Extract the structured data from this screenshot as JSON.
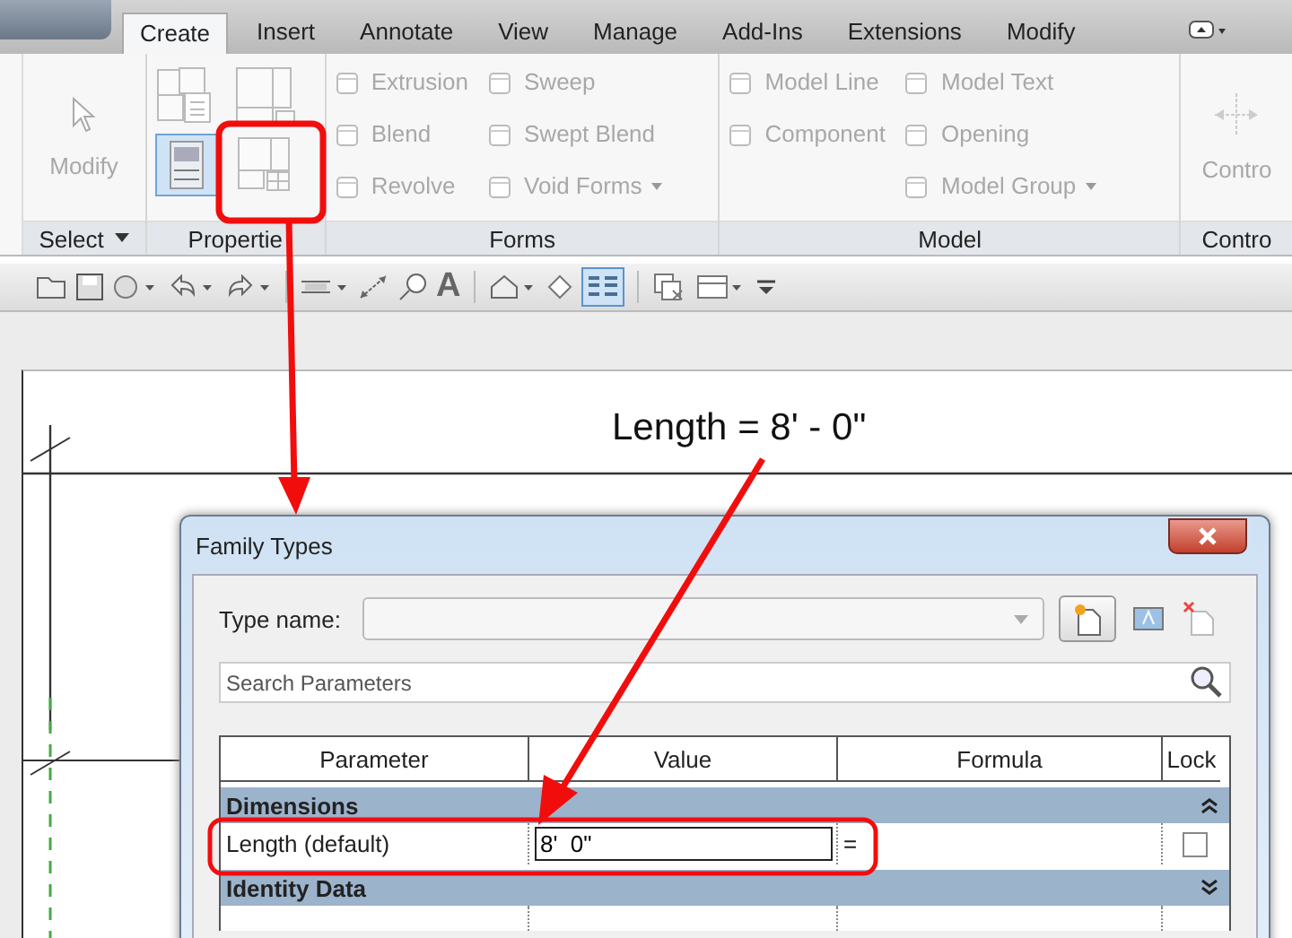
{
  "ribbon": {
    "tabs": [
      {
        "label": "Create",
        "selected": true
      },
      {
        "label": "Insert",
        "selected": false
      },
      {
        "label": "Annotate",
        "selected": false
      },
      {
        "label": "View",
        "selected": false
      },
      {
        "label": "Manage",
        "selected": false
      },
      {
        "label": "Add-Ins",
        "selected": false
      },
      {
        "label": "Extensions",
        "selected": false
      },
      {
        "label": "Modify",
        "selected": false
      }
    ],
    "select_panel": {
      "tool": "Modify",
      "label": "Select"
    },
    "properties_panel": {
      "label": "Propertie"
    },
    "forms_panel": {
      "label": "Forms",
      "columns": [
        [
          {
            "label": "Extrusion",
            "menu": false
          },
          {
            "label": "Blend",
            "menu": false
          },
          {
            "label": "Revolve",
            "menu": false
          }
        ],
        [
          {
            "label": "Sweep",
            "menu": false
          },
          {
            "label": "Swept Blend",
            "menu": false
          },
          {
            "label": "Void Forms",
            "menu": true
          }
        ]
      ]
    },
    "model_panel": {
      "label": "Model",
      "columns": [
        [
          {
            "label": "Model Line",
            "menu": false
          },
          {
            "label": "Component",
            "menu": false
          }
        ],
        [
          {
            "label": "Model Text",
            "menu": false
          },
          {
            "label": "Opening",
            "menu": false
          },
          {
            "label": "Model Group",
            "menu": true
          }
        ]
      ]
    },
    "control_panel": {
      "tool": "Contro",
      "label": "Contro"
    }
  },
  "quick_access": {
    "text_tool": "A"
  },
  "annotation": "Length = 8' - 0\"",
  "dialog": {
    "title": "Family Types",
    "type_name_label": "Type name:",
    "search": {
      "placeholder": "Search Parameters"
    },
    "columns": [
      "Parameter",
      "Value",
      "Formula",
      "Lock"
    ],
    "groups": [
      {
        "name": "Dimensions",
        "expanded": true,
        "rows": [
          {
            "parameter": "Length (default)",
            "value": "8'  0\"",
            "formula": "=",
            "locked": false
          }
        ]
      },
      {
        "name": "Identity Data",
        "expanded": false
      }
    ]
  }
}
